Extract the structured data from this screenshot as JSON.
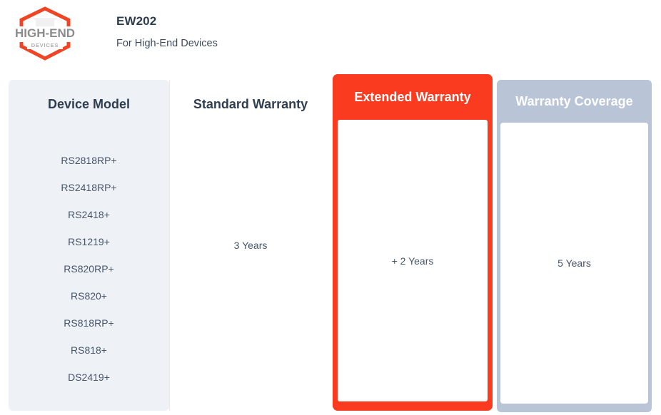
{
  "header": {
    "logo": {
      "primary_text": "HIGH-END",
      "secondary_text": "DEVICES",
      "shape": "hexagon-outline",
      "accent_color": "#f04525"
    },
    "product_code": "EW202",
    "tagline": "For High-End Devices"
  },
  "table": {
    "columns": [
      {
        "key": "device_model",
        "label": "Device Model",
        "style": "plain-light"
      },
      {
        "key": "standard_warranty",
        "label": "Standard Warranty",
        "style": "plain-white"
      },
      {
        "key": "extended_warranty",
        "label": "Extended Warranty",
        "style": "highlight-red"
      },
      {
        "key": "warranty_coverage",
        "label": "Warranty Coverage",
        "style": "highlight-grey"
      }
    ],
    "device_models": [
      "RS2818RP+",
      "RS2418RP+",
      "RS2418+",
      "RS1219+",
      "RS820RP+",
      "RS820+",
      "RS818RP+",
      "RS818+",
      "DS2419+"
    ],
    "values": {
      "standard_warranty": "3 Years",
      "extended_warranty": "+ 2 Years",
      "warranty_coverage": "5 Years"
    }
  },
  "colors": {
    "accent_red": "#fb3b20",
    "coverage_grey": "#b9c5d7",
    "device_panel": "#eef2f7",
    "heading_text": "#2f3e50",
    "body_text": "#46556a"
  }
}
